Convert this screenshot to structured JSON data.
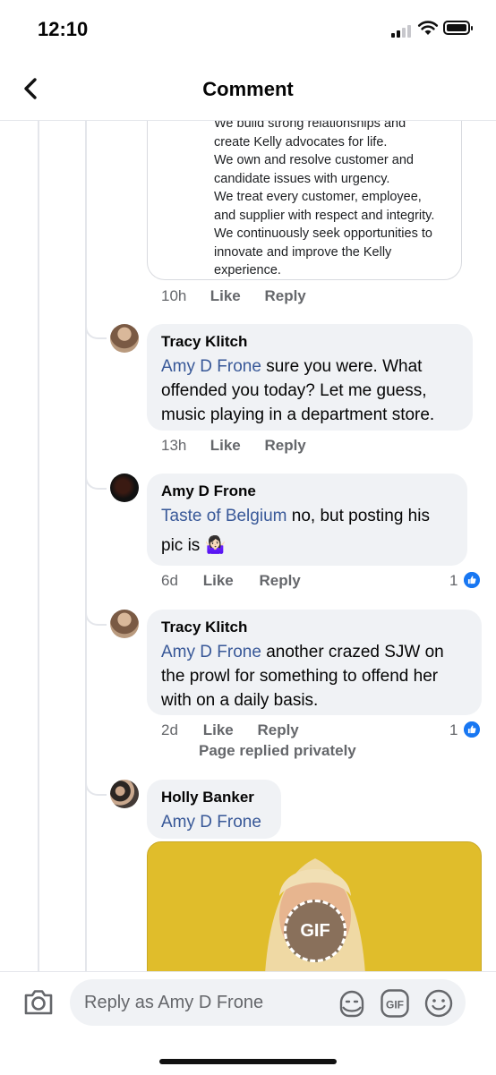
{
  "status_bar": {
    "time": "12:10"
  },
  "header": {
    "title": "Comment"
  },
  "shared_post": {
    "lines": [
      "We build strong relationships and",
      "create Kelly advocates for life.",
      "We own and resolve customer and",
      "candidate issues with urgency.",
      "We treat every customer, employee,",
      "and supplier with respect and integrity.",
      "We continuously seek opportunities to",
      "innovate and improve the Kelly",
      "experience."
    ],
    "time": "10h",
    "like": "Like",
    "reply": "Reply"
  },
  "comments": [
    {
      "author": "Tracy Klitch",
      "mention": "Amy D Frone",
      "line1_rest": " sure you were.  What",
      "line2": "offended you today? Let me guess,",
      "line3": "music playing in a department store.",
      "time": "13h",
      "like": "Like",
      "reply": "Reply"
    },
    {
      "author": "Amy D Frone",
      "mention": "Taste of Belgium",
      "line1_rest": " no, but posting his",
      "line2": "pic is",
      "emoji": "🤷🏻‍♀️",
      "time": "6d",
      "like": "Like",
      "reply": "Reply",
      "reactions": "1"
    },
    {
      "author": "Tracy Klitch",
      "mention": "Amy D Frone",
      "line1_rest": " another crazed SJW on",
      "line2": "the prowl for something to offend her",
      "line3": "with on a daily basis.",
      "time": "2d",
      "like": "Like",
      "reply": "Reply",
      "reactions": "1",
      "page_note": "Page replied privately"
    },
    {
      "author": "Holly Banker",
      "mention": "Amy D Frone",
      "gif_label": "GIF"
    }
  ],
  "composer": {
    "placeholder": "Reply as Amy D Frone",
    "icons": [
      "camera-icon",
      "sticker-icon",
      "gif-icon",
      "emoji-icon"
    ]
  },
  "colors": {
    "mention": "#385898",
    "like_blue": "#1877f2",
    "bubble": "#f0f2f5"
  }
}
